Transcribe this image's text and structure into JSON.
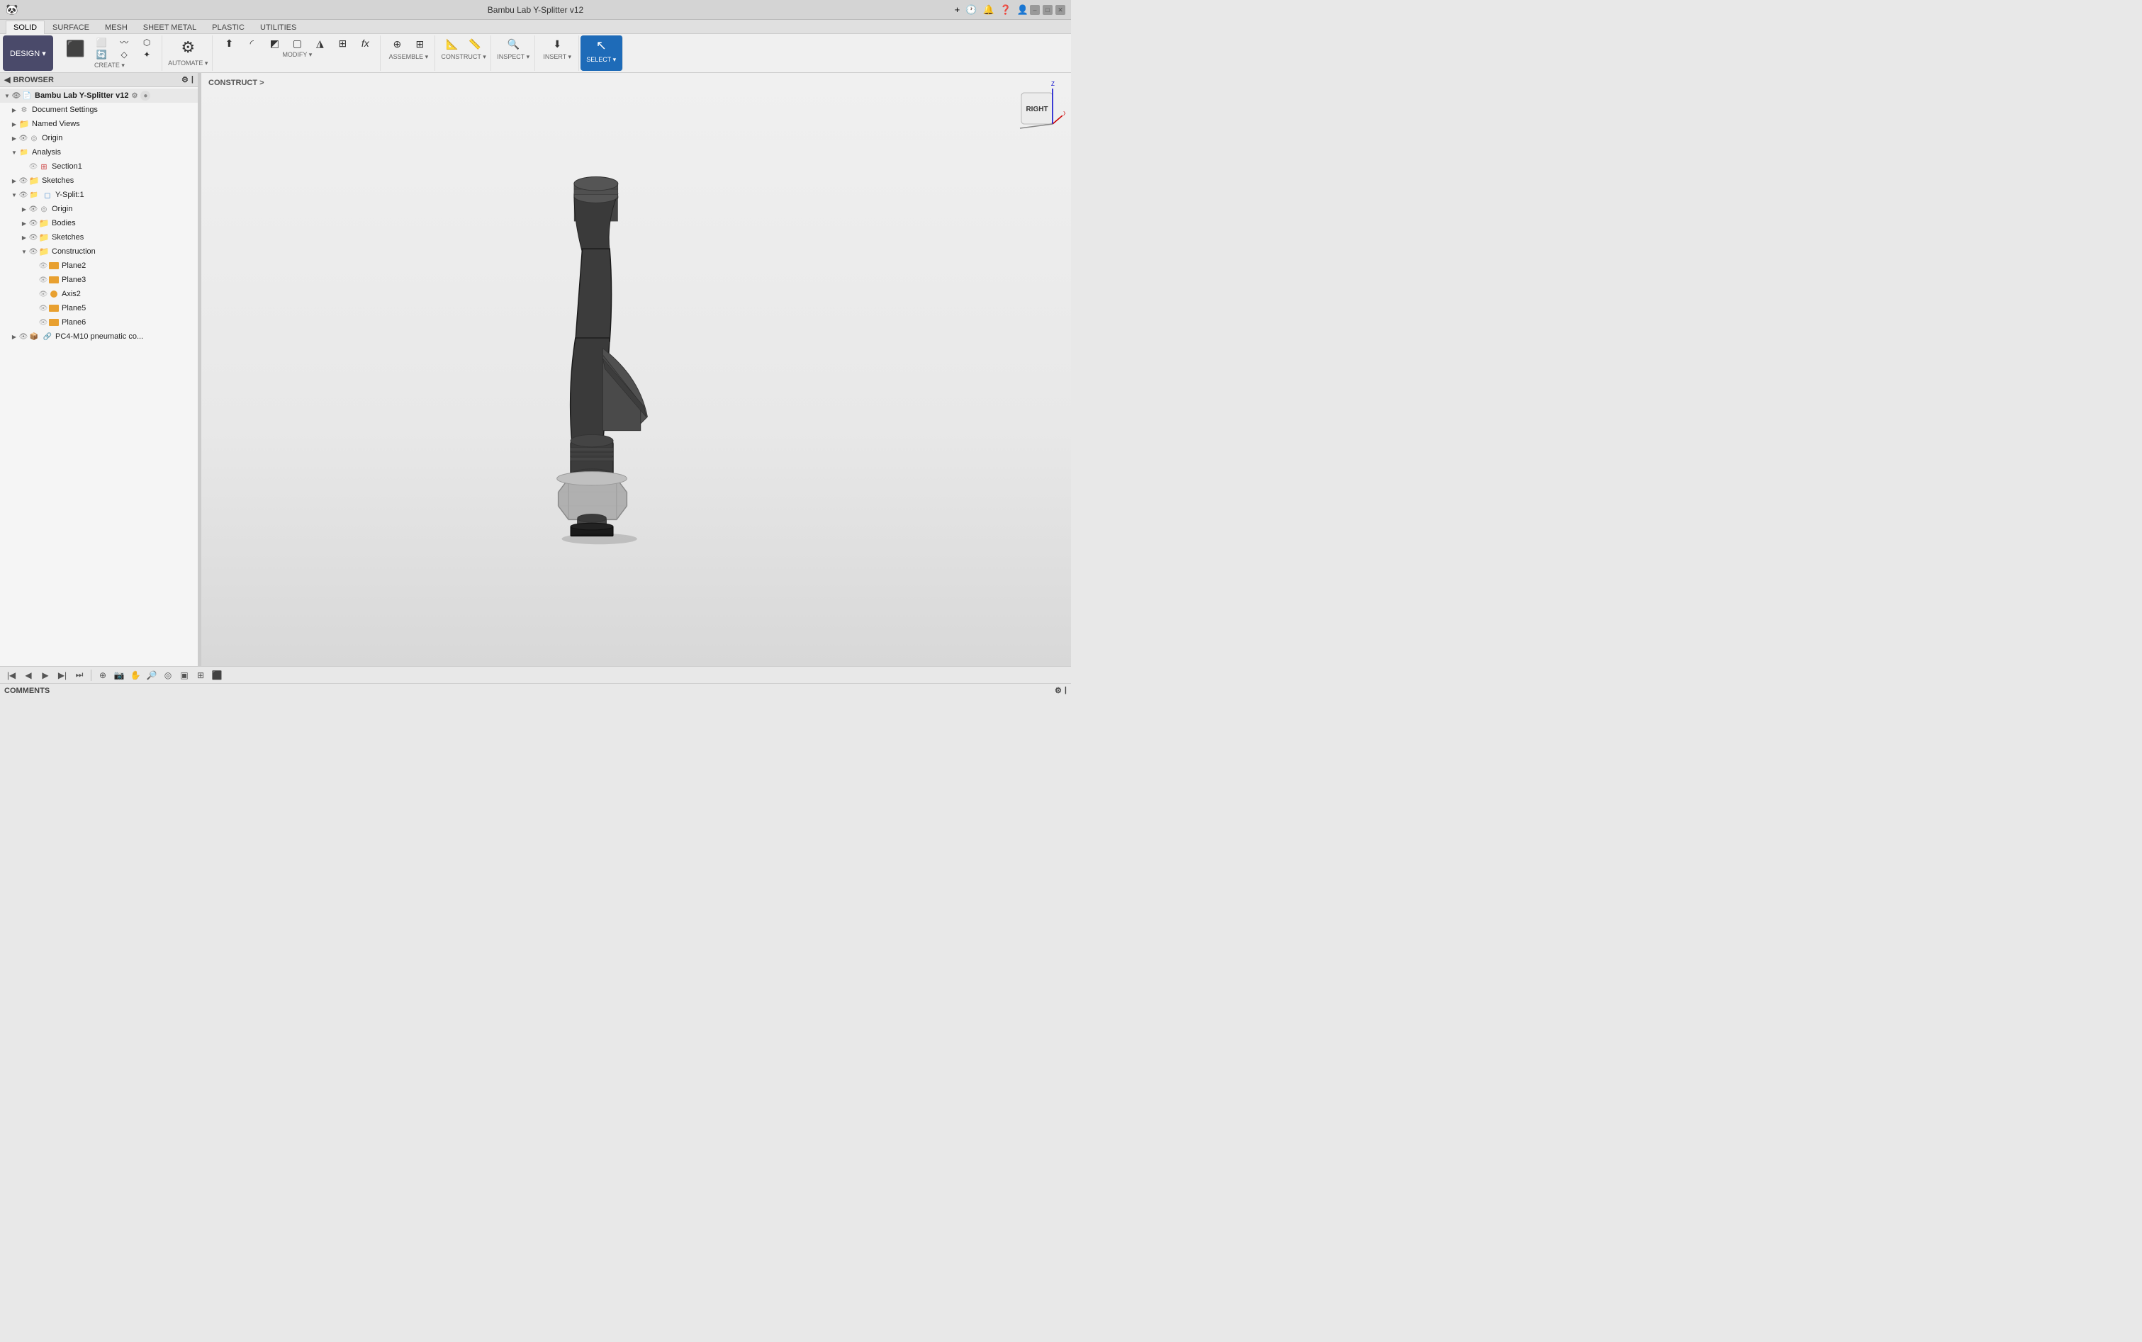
{
  "titleBar": {
    "title": "Bambu Lab Y-Splitter v12",
    "appIcon": "🐼",
    "closeBtn": "✕",
    "addBtn": "+",
    "clockIcon": "🕐",
    "bellIcon": "🔔",
    "helpIcon": "?",
    "profileIcon": "👤"
  },
  "ribbon": {
    "tabs": [
      "SOLID",
      "SURFACE",
      "MESH",
      "SHEET METAL",
      "PLASTIC",
      "UTILITIES"
    ],
    "activeTab": "SOLID",
    "designBtn": "DESIGN ▾",
    "groups": {
      "create": {
        "label": "CREATE ▾",
        "buttons": [
          "New Component",
          "Extrude",
          "Revolve",
          "Sweep",
          "Loft",
          "Rib"
        ]
      },
      "automate": {
        "label": "AUTOMATE ▾",
        "buttons": [
          "Automate"
        ]
      },
      "modify": {
        "label": "MODIFY ▾",
        "buttons": [
          "Press Pull",
          "Fillet",
          "Chamfer",
          "Shell",
          "Draft",
          "Scale",
          "fx"
        ]
      },
      "assemble": {
        "label": "ASSEMBLE ▾"
      },
      "construct": {
        "label": "CONSTRUCT ▾"
      },
      "inspect": {
        "label": "INSPECT ▾"
      },
      "insert": {
        "label": "INSERT ▾"
      },
      "select": {
        "label": "SELECT ▾"
      }
    }
  },
  "browser": {
    "title": "BROWSER",
    "items": [
      {
        "id": "root",
        "label": "Bambu Lab Y-Splitter v12",
        "indent": 0,
        "type": "root",
        "expanded": true,
        "hasEye": true
      },
      {
        "id": "doc-settings",
        "label": "Document Settings",
        "indent": 1,
        "type": "folder",
        "expanded": false,
        "hasEye": false
      },
      {
        "id": "named-views",
        "label": "Named Views",
        "indent": 1,
        "type": "folder",
        "expanded": false,
        "hasEye": false
      },
      {
        "id": "origin",
        "label": "Origin",
        "indent": 1,
        "type": "origin",
        "expanded": false,
        "hasEye": true
      },
      {
        "id": "analysis",
        "label": "Analysis",
        "indent": 1,
        "type": "folder",
        "expanded": true,
        "hasEye": false
      },
      {
        "id": "section1",
        "label": "Section1",
        "indent": 2,
        "type": "section",
        "expanded": false,
        "hasEye": true
      },
      {
        "id": "sketches",
        "label": "Sketches",
        "indent": 1,
        "type": "folder",
        "expanded": false,
        "hasEye": true
      },
      {
        "id": "ysplit",
        "label": "Y-Split:1",
        "indent": 1,
        "type": "component",
        "expanded": true,
        "hasEye": true
      },
      {
        "id": "origin2",
        "label": "Origin",
        "indent": 2,
        "type": "origin",
        "expanded": false,
        "hasEye": true
      },
      {
        "id": "bodies",
        "label": "Bodies",
        "indent": 2,
        "type": "folder",
        "expanded": false,
        "hasEye": true
      },
      {
        "id": "sketches2",
        "label": "Sketches",
        "indent": 2,
        "type": "folder",
        "expanded": false,
        "hasEye": true
      },
      {
        "id": "construction",
        "label": "Construction",
        "indent": 2,
        "type": "folder",
        "expanded": true,
        "hasEye": true
      },
      {
        "id": "plane2",
        "label": "Plane2",
        "indent": 3,
        "type": "plane",
        "expanded": false,
        "hasEye": true
      },
      {
        "id": "plane3",
        "label": "Plane3",
        "indent": 3,
        "type": "plane",
        "expanded": false,
        "hasEye": true
      },
      {
        "id": "axis3",
        "label": "Axis2",
        "indent": 3,
        "type": "axis",
        "expanded": false,
        "hasEye": true
      },
      {
        "id": "plane5",
        "label": "Plane5",
        "indent": 3,
        "type": "plane",
        "expanded": false,
        "hasEye": true
      },
      {
        "id": "plane6",
        "label": "Plane6",
        "indent": 3,
        "type": "plane",
        "expanded": false,
        "hasEye": true
      },
      {
        "id": "pc4m10",
        "label": "PC4-M10 pneumatic co...",
        "indent": 1,
        "type": "link",
        "expanded": false,
        "hasEye": true
      }
    ]
  },
  "viewport": {
    "constructLabel": "CONSTRUCT >",
    "viewCube": {
      "face": "RIGHT"
    }
  },
  "bottomToolbar": {
    "buttons": [
      "⊕",
      "🔲",
      "⊞",
      "⊟",
      "🔎",
      "◉",
      "▣",
      "⬛"
    ]
  },
  "comments": {
    "label": "COMMENTS"
  },
  "playback": {
    "buttons": [
      "|◀",
      "◀",
      "▶",
      "▶|",
      "⏭"
    ]
  }
}
